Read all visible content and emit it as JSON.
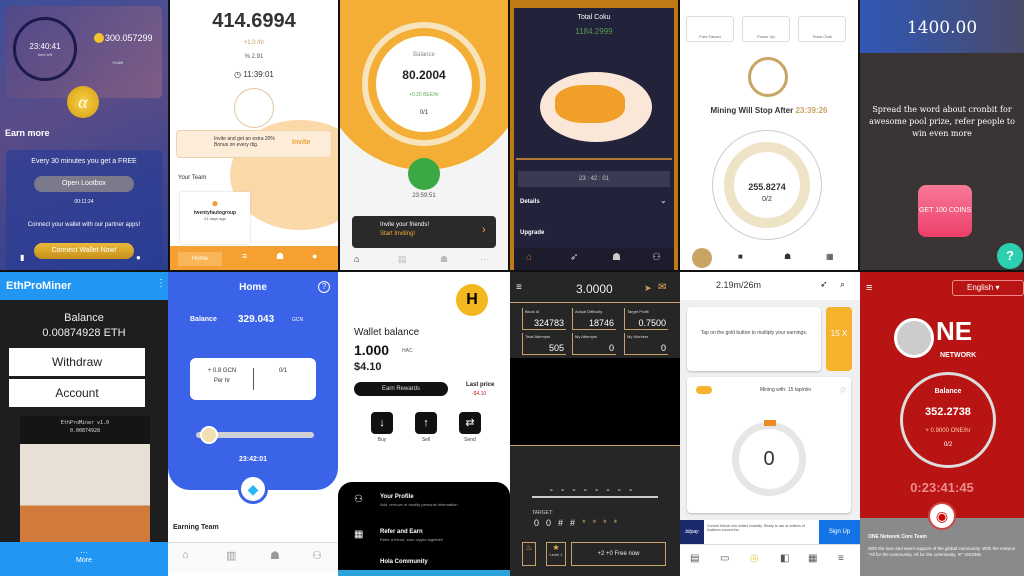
{
  "panels": {
    "alpha": {
      "timer": "23:40:41",
      "timer_caption": "time left",
      "balance": "300.057299",
      "rate": "+0.8/h",
      "earn_more": "Earn more",
      "free_text": "Every 30 minutes you get a FREE",
      "lootbox_button": "Open Lootbox",
      "lootbox_timer": "00:11:24",
      "partner_text": "Connect your wallet with our partner apps!",
      "connect_button": "Connect Wallet Now!"
    },
    "dig": {
      "balance": "414.6994",
      "rate": "+1.0 /hr",
      "percent": "% 2.91",
      "timer": "11:39:01",
      "invite_text": "Invite and get an extra 20% Bonus on every dig.",
      "invite_link": "Invite",
      "team_label": "Your Team",
      "member_name": "twentyfautogroup",
      "member_time": "21 days ago",
      "nav_home": "Home"
    },
    "bee": {
      "balance_label": "Balance",
      "balance": "80.2004",
      "rate": "+0.20 BEE/hr",
      "team": "0/1",
      "timer": "23:59:51",
      "invite_title": "Invite your friends!",
      "invite_cta": "Start Inviting!"
    },
    "coku": {
      "title": "Total Coku",
      "value": "1184.2999",
      "timer": "23 : 42 : 01",
      "details": "Details",
      "upgrade": "Upgrade"
    },
    "pi_like": {
      "tabs": [
        "Free Faucet",
        "Power Up",
        "Team Chat"
      ],
      "mining_label": "Mining Will Stop After",
      "mining_timer": "23:39:26",
      "balance": "255.8274",
      "team": "0/2",
      "nav": [
        "Home",
        "Wallet",
        "Team",
        "More"
      ]
    },
    "cronbit": {
      "balance": "1400.00",
      "message": "Spread the word about cronbit for awesome pool prize, refer people to win even more",
      "button": "GET 100 COINS",
      "help": "?"
    },
    "ethprominer": {
      "title": "EthProMiner",
      "balance_label": "Balance",
      "balance": "0.00874928 ETH",
      "withdraw": "Withdraw",
      "account": "Account",
      "game_title": "EthProMiner v1.0",
      "game_balance": "0.00874928",
      "more": "More"
    },
    "gcn": {
      "title": "Home",
      "balance_label": "Balance",
      "balance": "329.043",
      "unit": "GCN",
      "rate": "+ 0.8 GCN",
      "rate_unit": "Per hr",
      "team": "0/1",
      "progress": 0.05,
      "timer": "23:42:01",
      "earning_team": "Earning Team"
    },
    "hola": {
      "wallet_label": "Wallet balance",
      "balance": "1.000",
      "unit": "HAC",
      "usd": "$4.10",
      "earn_button": "Earn Rewards",
      "last_price_label": "Last price",
      "last_price": "-$4.10",
      "actions": [
        "Buy",
        "Sell",
        "Send"
      ],
      "menu": [
        {
          "title": "Your Profile",
          "sub": "Add, remove or modify personal information"
        },
        {
          "title": "Refer and Earn",
          "sub": "Refer a friend, earn crypto together!"
        },
        {
          "title": "Hola Community",
          "sub": ""
        }
      ]
    },
    "hash": {
      "balance": "3.0000",
      "stats": [
        {
          "label": "Block Id",
          "value": "324783"
        },
        {
          "label": "Actual Difficulty",
          "value": "18746"
        },
        {
          "label": "Target Profit",
          "value": "0.7500"
        },
        {
          "label": "Total Attempts",
          "value": "505"
        },
        {
          "label": "My Attempts",
          "value": "0"
        },
        {
          "label": "My Workers",
          "value": "0"
        }
      ],
      "target_label": "TARGET:",
      "target": [
        "0",
        "0",
        "#",
        "#",
        "*",
        "*",
        "*",
        "*"
      ],
      "level_label": "Level 1",
      "free_button": "+2 +0 Free now"
    },
    "tapper": {
      "title": "2.19m/26m",
      "tip": "Tap on the gold button to multiply your earnings.",
      "multiplier": "15 X",
      "mining_with": "Mining with: 15 tap/min",
      "count": "0",
      "ad_brand": "bitpay",
      "ad_text": "Convert bitcoin into dollars instantly. Ready to use at millions of locations around the...",
      "ad_button": "Sign Up"
    },
    "one": {
      "language": "English",
      "brand": "NETWORK",
      "balance_label": "Balance",
      "balance": "352.2738",
      "rate": "+ 0.9000 ONE/hr",
      "team": "0/2",
      "timer": "0:23:41:45",
      "footer_title": "ONE Network Core Team",
      "footer_text": "With the love and warm support of the global community. With the mission \"All for the community. All for the community. !!!\" VIKONE"
    }
  }
}
